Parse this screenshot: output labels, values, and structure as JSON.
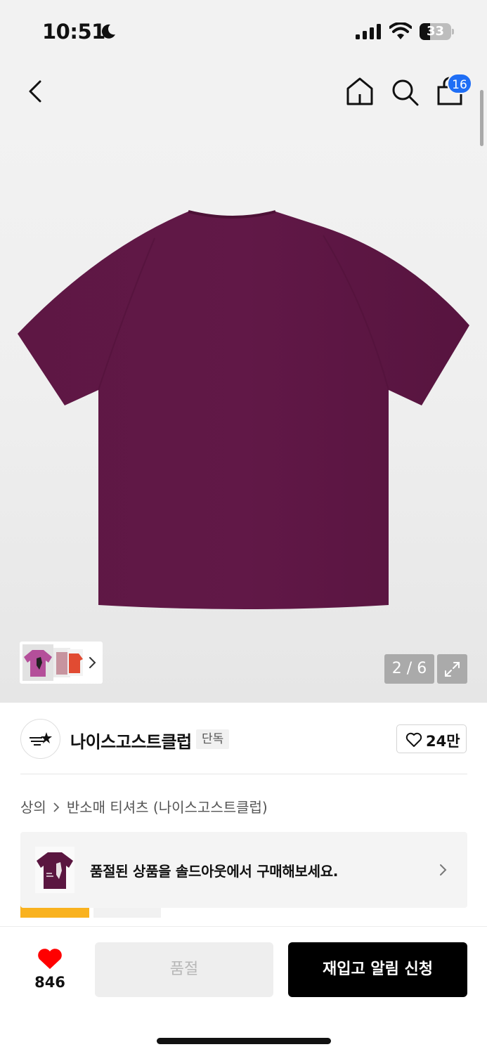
{
  "status_bar": {
    "time": "10:51",
    "battery": "33",
    "battery_fraction": 0.33
  },
  "header": {
    "cart_badge_count": "16",
    "icons": [
      "back-icon",
      "home-icon",
      "search-icon",
      "cart-icon"
    ]
  },
  "gallery": {
    "page_indicator": "2 / 6",
    "product_color": "#5a1640"
  },
  "brand": {
    "name": "나이스고스트클럽",
    "badge": "단독",
    "likes": "24만"
  },
  "breadcrumb": {
    "category": "상의",
    "subcategory": "반소매 티셔츠 (나이스고스트클럽)"
  },
  "promo": {
    "text": "품절된 상품을 솔드아웃에서 구매해보세요."
  },
  "bottom_bar": {
    "wish_count": "846",
    "soldout_label": "품절",
    "restock_label": "재입고 알림 신청",
    "accent_color": "#ff0000"
  }
}
